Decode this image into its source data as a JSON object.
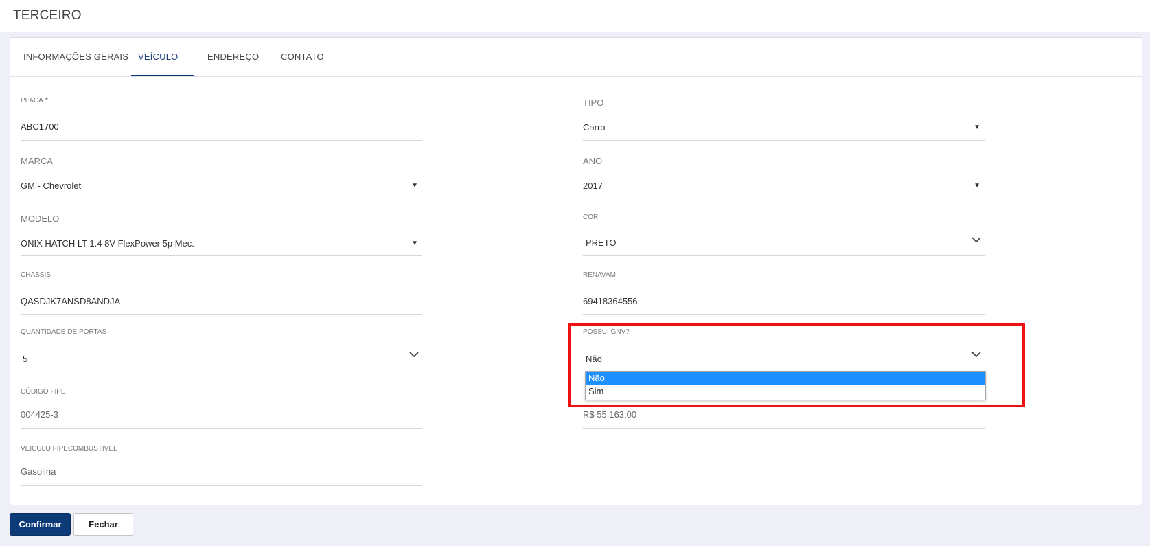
{
  "header": {
    "title": "TERCEIRO"
  },
  "tabs": [
    {
      "label": "INFORMAÇÕES GERAIS"
    },
    {
      "label": "VEÍCULO"
    },
    {
      "label": "ENDEREÇO"
    },
    {
      "label": "CONTATO"
    }
  ],
  "fields": {
    "placa": {
      "label": "PLACA",
      "required_mark": "*",
      "value": "ABC1700"
    },
    "tipo": {
      "label": "TIPO",
      "value": "Carro"
    },
    "marca": {
      "label": "MARCA",
      "value": "GM - Chevrolet"
    },
    "ano": {
      "label": "ANO",
      "value": "2017"
    },
    "modelo": {
      "label": "MODELO",
      "value": "ONIX HATCH LT 1.4 8V FlexPower 5p Mec."
    },
    "cor": {
      "label": "COR",
      "value": "PRETO"
    },
    "chassis": {
      "label": "CHASSIS",
      "value": "QASDJK7ANSD8ANDJA"
    },
    "renavam": {
      "label": "RENAVAM",
      "value": "69418364556"
    },
    "portas": {
      "label": "QUANTIDADE DE PORTAS",
      "value": "5"
    },
    "gnv": {
      "label": "POSSUI GNV?",
      "value": "Não",
      "options": [
        "Não",
        "Sim"
      ],
      "selected_index": 0
    },
    "codigo_fipe": {
      "label": "CÓDIGO FIPE",
      "value": "004425-3"
    },
    "valor_fipe": {
      "value": "R$ 55.163,00"
    },
    "combustivel": {
      "label": "VEICULO FIPECOMBUSTIVEL",
      "value": "Gasolina"
    }
  },
  "buttons": {
    "confirm": "Confirmar",
    "close": "Fechar"
  },
  "colors": {
    "primary": "#0d3b78",
    "highlight": "#ee1111",
    "option_selected": "#1e90ff"
  }
}
